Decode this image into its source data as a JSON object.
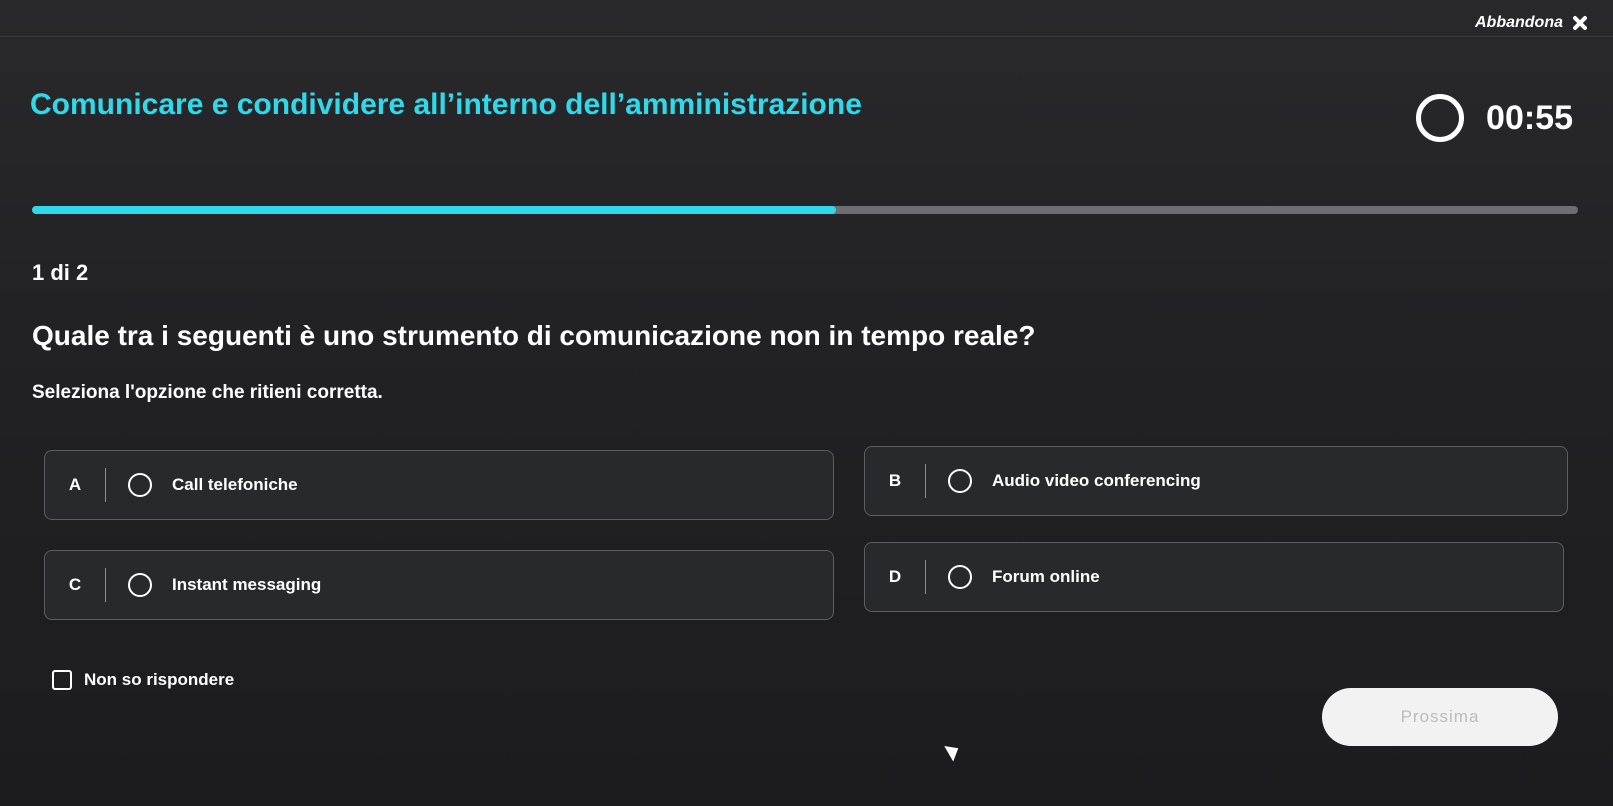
{
  "header": {
    "leave_label": "Abbandona",
    "leave_icon": "close-icon"
  },
  "course": {
    "title_highlight": "Comunicare e condividere all’interno dell’amministrazione"
  },
  "timer": {
    "icon": "timer-ring-icon",
    "value": "00:55"
  },
  "progress": {
    "fraction": 0.52,
    "color": "#2fd9ea"
  },
  "quiz": {
    "counter": "1 di 2",
    "question": "Quale tra i seguenti è uno strumento di comunicazione non in tempo reale?",
    "instruction": "Seleziona l'opzione che ritieni corretta.",
    "options": [
      {
        "letter": "A",
        "label": "Call telefoniche"
      },
      {
        "letter": "B",
        "label": "Audio video conferencing"
      },
      {
        "letter": "C",
        "label": "Instant messaging"
      },
      {
        "letter": "D",
        "label": "Forum online"
      }
    ],
    "dont_know_label": "Non so rispondere",
    "next_label": "Prossima"
  },
  "colors": {
    "accent": "#2fd9ea",
    "background": "#222225"
  }
}
